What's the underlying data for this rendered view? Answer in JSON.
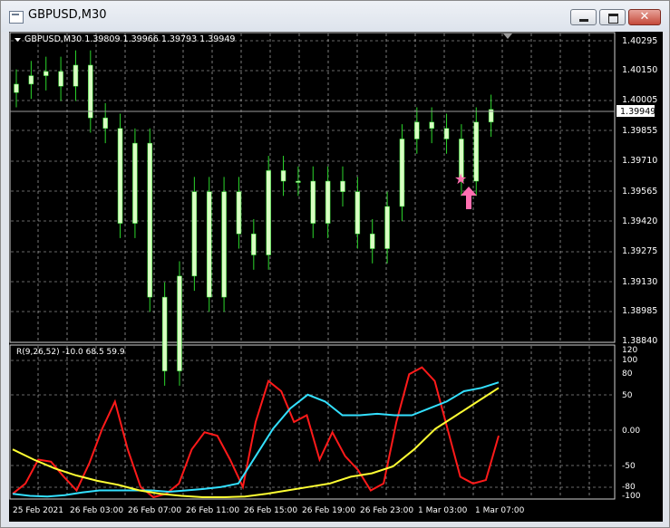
{
  "window": {
    "title": "GBPUSD,M30",
    "minimize_icon": "minimize-icon",
    "maximize_icon": "maximize-icon",
    "close_icon": "close-icon"
  },
  "colors": {
    "background": "#000000",
    "grid": "#cfcfcf",
    "candle": "#d8ffc2",
    "wick": "#2bd62b",
    "price_line": "#9a9a9a",
    "red_line": "#ff1a1a",
    "cyan_line": "#33e0ff",
    "yellow_line": "#ffff33",
    "marker": "#ff6fb0",
    "text": "#ffffff"
  },
  "main_chart": {
    "info": "GBPUSD,M30  1.39809 1.39966 1.39793 1.39949",
    "price_ticks": [
      "1.40295",
      "1.40150",
      "1.40005",
      "1.39855",
      "1.39710",
      "1.39565",
      "1.39420",
      "1.39275",
      "1.39130",
      "1.38985",
      "1.38840"
    ],
    "current_price": "1.39949",
    "marker_icons": [
      "star-icon",
      "arrow-up-icon"
    ]
  },
  "indicator": {
    "label": "R(9,26,52) -10.0 68.5 59.9",
    "ticks": [
      "120",
      "100",
      "80",
      "50",
      "0.00",
      "-50",
      "-80",
      "-100"
    ]
  },
  "time_axis": {
    "labels": [
      "25 Feb 2021",
      "26 Feb 03:00",
      "26 Feb 07:00",
      "26 Feb 11:00",
      "26 Feb 15:00",
      "26 Feb 19:00",
      "26 Feb 23:00",
      "1 Mar 03:00",
      "1 Mar 07:00"
    ]
  },
  "chart_data": [
    {
      "type": "candlestick",
      "symbol": "GBPUSD",
      "timeframe": "M30",
      "ohlc": [
        1.39809,
        1.39966,
        1.39793,
        1.39949
      ],
      "ylim": [
        1.3884,
        1.403
      ],
      "x": [
        "25 Feb 2021",
        "26 Feb 03:00",
        "26 Feb 07:00",
        "26 Feb 11:00",
        "26 Feb 15:00",
        "26 Feb 19:00",
        "26 Feb 23:00",
        "1 Mar 03:00",
        "1 Mar 07:00"
      ],
      "close_approx": [
        1.4006,
        1.401,
        1.4012,
        1.4005,
        1.4015,
        1.399,
        1.3985,
        1.394,
        1.3978,
        1.3905,
        1.387,
        1.3915,
        1.3955,
        1.3905,
        1.3955,
        1.3935,
        1.3925,
        1.3965,
        1.396,
        1.396,
        1.394,
        1.396,
        1.3955,
        1.3935,
        1.3928,
        1.3948,
        1.398,
        1.3988,
        1.3985,
        1.398,
        1.396,
        1.3988,
        1.3994
      ]
    },
    {
      "type": "line",
      "title": "R(9,26,52)",
      "ylim": [
        -100,
        120
      ],
      "series": [
        {
          "values": [
            -95,
            -80,
            -45,
            -48,
            -70,
            -90,
            -50,
            0,
            40,
            -30,
            -85,
            -100,
            -95,
            -80,
            -30,
            -5,
            -10,
            -45,
            -85,
            10,
            70,
            55,
            10,
            20,
            -45,
            -5,
            -40,
            -60,
            -90,
            -80,
            10,
            80,
            90,
            70,
            0,
            -70,
            -80,
            -75,
            -10
          ]
        },
        {
          "values": [
            -95,
            -98,
            -99,
            -97,
            -93,
            -90,
            -90,
            -90,
            -90,
            -92,
            -90,
            -88,
            -85,
            -80,
            -40,
            0,
            30,
            50,
            40,
            20,
            20,
            22,
            20,
            20,
            30,
            40,
            55,
            60,
            68
          ]
        },
        {
          "values": [
            -30,
            -45,
            -58,
            -68,
            -76,
            -82,
            -90,
            -95,
            -98,
            -100,
            -100,
            -99,
            -95,
            -90,
            -85,
            -80,
            -70,
            -65,
            -55,
            -30,
            0,
            20,
            40,
            60
          ]
        }
      ]
    }
  ]
}
